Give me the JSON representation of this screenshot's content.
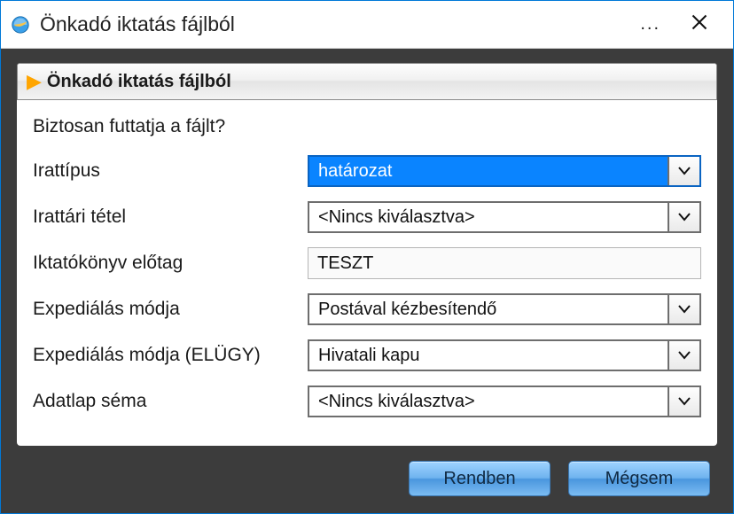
{
  "window": {
    "title": "Önkadó iktatás fájlból"
  },
  "panel": {
    "header": "Önkadó iktatás fájlból",
    "confirm": "Biztosan futtatja a fájlt?"
  },
  "form": {
    "irattipus_label": "Irattípus",
    "irattipus_value": "határozat",
    "irattari_label": "Irattári tétel",
    "irattari_value": "<Nincs kiválasztva>",
    "iktatokonyv_label": "Iktatókönyv előtag",
    "iktatokonyv_value": "TESZT",
    "expedialas_label": "Expediálás módja",
    "expedialas_value": "Postával kézbesítendő",
    "expedialas_elugy_label": "Expediálás módja (ELÜGY)",
    "expedialas_elugy_value": "Hivatali kapu",
    "adatlap_label": "Adatlap séma",
    "adatlap_value": "<Nincs kiválasztva>"
  },
  "buttons": {
    "ok": "Rendben",
    "cancel": "Mégsem"
  }
}
